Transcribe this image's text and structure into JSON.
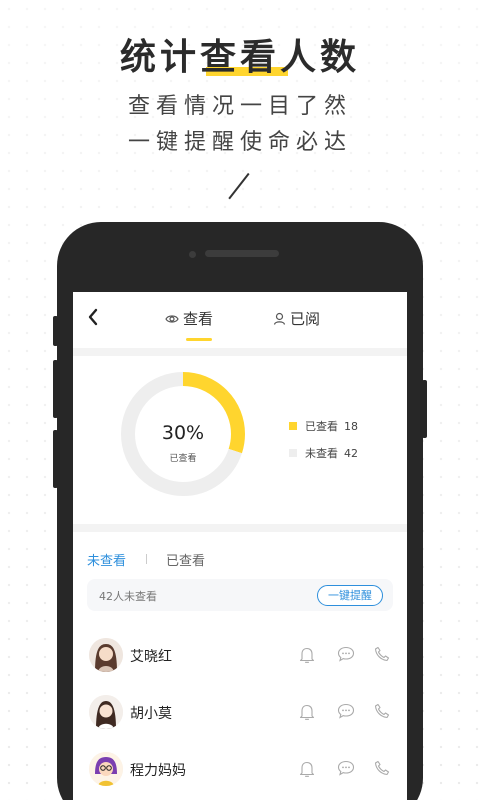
{
  "headline": "统计查看人数",
  "subline1": "查看情况一目了然",
  "subline2": "一键提醒使命必达",
  "app": {
    "tabs": {
      "view_label": "查看",
      "read_label": "已阅"
    },
    "chart_data": {
      "type": "pie",
      "style": "donut",
      "center_value": "30%",
      "center_label": "已查看",
      "series": [
        {
          "name": "已查看",
          "value": 18,
          "color": "#ffd52e"
        },
        {
          "name": "未查看",
          "value": 42,
          "color": "#eeeeee"
        }
      ]
    },
    "legend": {
      "viewed_label": "已查看",
      "viewed_count": "18",
      "unviewed_label": "未查看",
      "unviewed_count": "42"
    },
    "filter": {
      "unviewed": "未查看",
      "viewed": "已查看"
    },
    "summary": {
      "text": "42人未查看",
      "remind_button": "一键提醒"
    },
    "contacts": [
      {
        "name": "艾晓红"
      },
      {
        "name": "胡小莫"
      },
      {
        "name": "程力妈妈"
      }
    ],
    "colors": {
      "accent_yellow": "#ffd52e",
      "link_blue": "#2e8fdc",
      "phone_body": "#272727"
    }
  }
}
